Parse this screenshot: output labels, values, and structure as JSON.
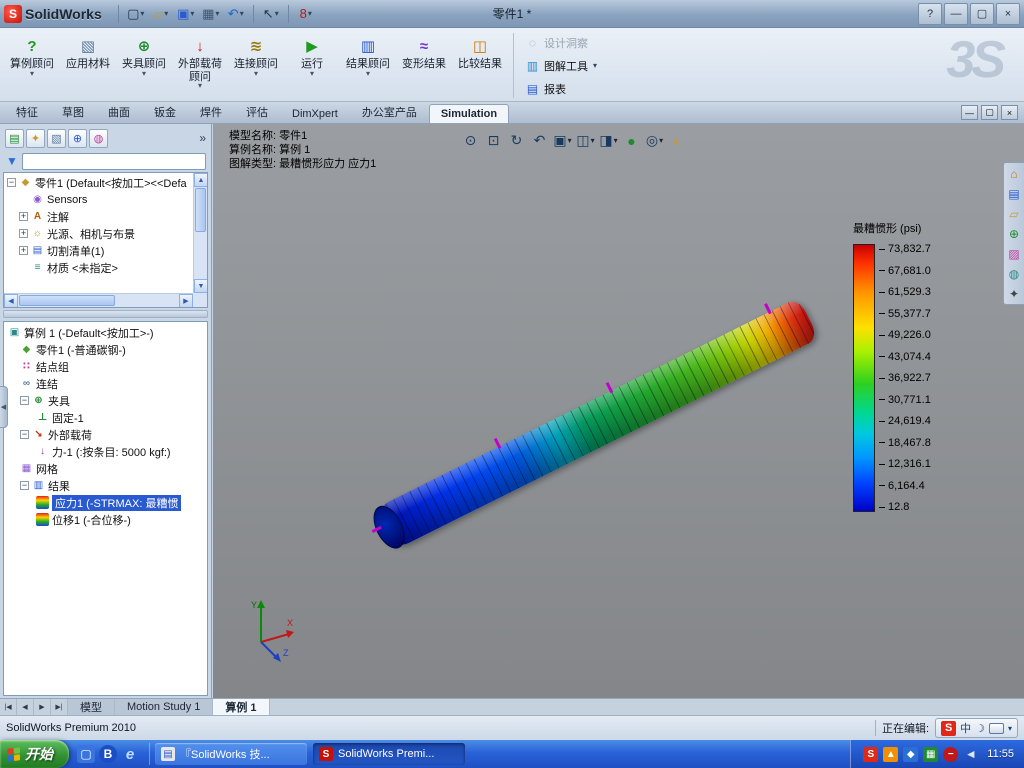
{
  "icons": {
    "new": "▢",
    "open": "▱",
    "save": "▣",
    "print": "▦",
    "undo": "↶",
    "select": "↖",
    "rebuild": "8",
    "help": "?",
    "minimize": "—",
    "maximize": "▢",
    "close": "×",
    "chevron_right": "»"
  },
  "titlebar": {
    "app_name": "SolidWorks",
    "doc_title": "零件1 *"
  },
  "ribbon": {
    "watermark": "3S",
    "buttons": [
      {
        "label": "算例顾问"
      },
      {
        "label": "应用材料"
      },
      {
        "label": "夹具顾问"
      },
      {
        "label": "外部载荷顾问"
      },
      {
        "label": "连接顾问"
      },
      {
        "label": "运行"
      },
      {
        "label": "结果顾问"
      },
      {
        "label": "变形结果"
      },
      {
        "label": "比较结果"
      }
    ],
    "side_buttons": [
      {
        "label": "设计洞察"
      },
      {
        "label": "图解工具"
      },
      {
        "label": "报表"
      }
    ]
  },
  "command_tabs": {
    "items": [
      "特征",
      "草图",
      "曲面",
      "钣金",
      "焊件",
      "评估",
      "DimXpert",
      "办公室产品",
      "Simulation"
    ],
    "active": "Simulation"
  },
  "feature_tree": {
    "root": "零件1 (Default<按加工><<Defa",
    "items": [
      "Sensors",
      "注解",
      "光源、相机与布景",
      "切割清单(1)",
      "材质 <未指定>"
    ]
  },
  "study_tree": {
    "items": [
      "算例 1 (-Default<按加工>-)",
      "零件1 (-普通碳钢-)",
      "结点组",
      "连结",
      "夹具",
      "固定-1",
      "外部载荷",
      "力-1 (:按条目: 5000 kgf:)",
      "网格",
      "结果",
      "应力1 (-STRMAX: 最糟惯",
      "位移1 (-合位移-)"
    ]
  },
  "viewport": {
    "info": [
      "模型名称: 零件1",
      "算例名称: 算例 1",
      "图解类型: 最糟惯形应力 应力1"
    ],
    "triad": {
      "x": "X",
      "y": "Y",
      "z": "Z"
    }
  },
  "legend": {
    "title": "最糟惯形 (psi)",
    "values": [
      "73,832.7",
      "67,681.0",
      "61,529.3",
      "55,377.7",
      "49,226.0",
      "43,074.4",
      "36,922.7",
      "30,771.1",
      "24,619.4",
      "18,467.8",
      "12,316.1",
      "6,164.4",
      "12.8"
    ]
  },
  "sheet_tabs": {
    "items": [
      "模型",
      "Motion Study 1",
      "算例 1"
    ],
    "active": "算例 1"
  },
  "statusbar": {
    "product": "SolidWorks Premium 2010",
    "editing": "正在编辑:",
    "lang": "中",
    "ime": "S"
  },
  "taskbar": {
    "start": "开始",
    "tasks": [
      "『SolidWorks 技...",
      "SolidWorks Premi..."
    ],
    "tray_ime": "S",
    "clock": "11:55"
  }
}
